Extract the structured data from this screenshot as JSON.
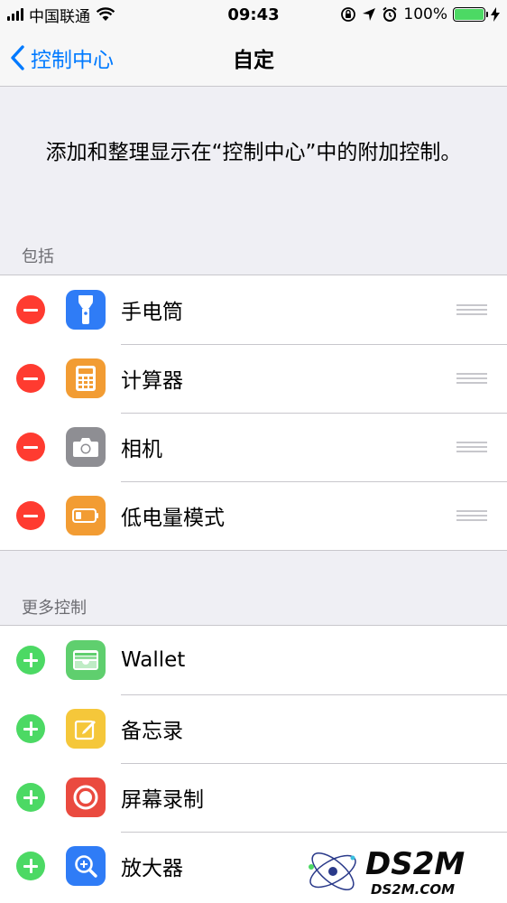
{
  "status_bar": {
    "carrier": "中国联通",
    "time": "09:43",
    "battery_percent": "100%",
    "battery_level": 1.0
  },
  "nav": {
    "back_label": "控制中心",
    "title": "自定"
  },
  "description": "添加和整理显示在“控制中心”中的附加控制。",
  "included": {
    "header": "包括",
    "items": [
      {
        "label": "手电筒",
        "icon": "flashlight-icon",
        "color": "#2f7cf6"
      },
      {
        "label": "计算器",
        "icon": "calculator-icon",
        "color": "#f29c33"
      },
      {
        "label": "相机",
        "icon": "camera-icon",
        "color": "#8e8e93"
      },
      {
        "label": "低电量模式",
        "icon": "low-power-battery-icon",
        "color": "#f29c33"
      }
    ]
  },
  "more": {
    "header": "更多控制",
    "items": [
      {
        "label": "Wallet",
        "icon": "wallet-icon",
        "color": "#5fcf6e"
      },
      {
        "label": "备忘录",
        "icon": "notes-icon",
        "color": "#f5c73a"
      },
      {
        "label": "屏幕录制",
        "icon": "screen-record-icon",
        "color": "#ea4a3f"
      },
      {
        "label": "放大器",
        "icon": "magnifier-icon",
        "color": "#2f7cf6"
      }
    ]
  },
  "watermark": {
    "text": "DS2M",
    "domain": "DS2M.COM"
  },
  "colors": {
    "accent": "#007aff",
    "remove": "#ff3b30",
    "add": "#4cd964"
  }
}
